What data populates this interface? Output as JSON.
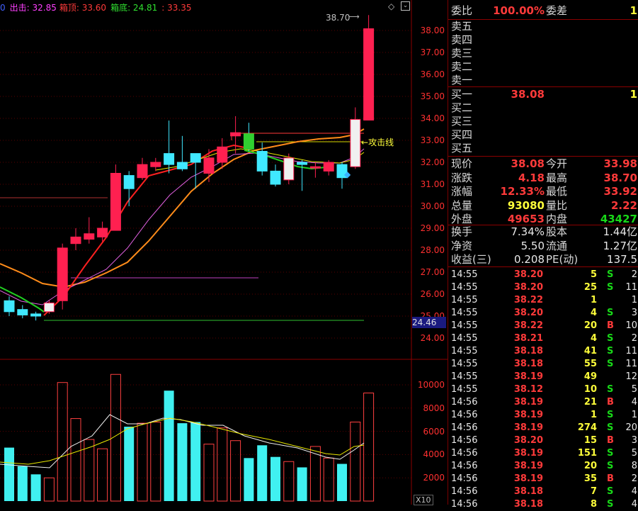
{
  "legend": {
    "prefix": "0",
    "chuji": "出击: 32.85",
    "xiangding": "箱顶: 33.60",
    "xiangdi": "箱底: 24.81",
    "extra": ": 33.35"
  },
  "chart_labels": {
    "peak": "38.70",
    "attack_line": "攻击线",
    "price_tag": "24.46",
    "vol_unit": "X10"
  },
  "price_axis": [
    "38.00",
    "37.00",
    "36.00",
    "35.00",
    "34.00",
    "33.00",
    "32.00",
    "31.00",
    "30.00",
    "29.00",
    "28.00",
    "27.00",
    "26.00",
    "25.00",
    "24.00"
  ],
  "vol_axis": [
    "10000",
    "8000",
    "6000",
    "4000",
    "2000"
  ],
  "chart_data": {
    "type": "candlestick",
    "ylim": [
      23.6,
      38.9
    ],
    "candles": [
      {
        "o": 25.7,
        "c": 25.2,
        "h": 25.9,
        "l": 25.0,
        "up": false
      },
      {
        "o": 25.3,
        "c": 25.05,
        "h": 25.5,
        "l": 24.9,
        "up": false
      },
      {
        "o": 25.1,
        "c": 25.0,
        "h": 25.2,
        "l": 24.8,
        "up": false
      },
      {
        "o": 25.2,
        "c": 25.6,
        "h": 25.7,
        "l": 25.1,
        "up": true,
        "white": true
      },
      {
        "o": 25.7,
        "c": 28.1,
        "h": 28.3,
        "l": 25.3,
        "up": true
      },
      {
        "o": 28.3,
        "c": 28.6,
        "h": 29.0,
        "l": 28.0,
        "up": true
      },
      {
        "o": 28.5,
        "c": 28.75,
        "h": 29.5,
        "l": 28.3,
        "up": true
      },
      {
        "o": 28.6,
        "c": 29.0,
        "h": 29.3,
        "l": 28.4,
        "up": true
      },
      {
        "o": 28.9,
        "c": 31.5,
        "h": 31.9,
        "l": 28.9,
        "up": true
      },
      {
        "o": 31.4,
        "c": 30.8,
        "h": 31.6,
        "l": 30.0,
        "up": false
      },
      {
        "o": 31.3,
        "c": 31.9,
        "h": 32.2,
        "l": 31.2,
        "up": true
      },
      {
        "o": 31.8,
        "c": 32.0,
        "h": 32.2,
        "l": 31.6,
        "up": true
      },
      {
        "o": 32.4,
        "c": 31.9,
        "h": 33.9,
        "l": 31.5,
        "up": false
      },
      {
        "o": 32.0,
        "c": 31.7,
        "h": 33.2,
        "l": 31.6,
        "up": false
      },
      {
        "o": 32.4,
        "c": 32.0,
        "h": 32.4,
        "l": 30.8,
        "up": false
      },
      {
        "o": 31.5,
        "c": 32.2,
        "h": 32.6,
        "l": 31.1,
        "up": true
      },
      {
        "o": 32.0,
        "c": 32.7,
        "h": 33.1,
        "l": 31.7,
        "up": true
      },
      {
        "o": 33.2,
        "c": 33.35,
        "h": 34.1,
        "l": 32.4,
        "up": true
      },
      {
        "o": 33.3,
        "c": 32.6,
        "h": 33.8,
        "l": 32.5,
        "up": false,
        "green": true
      },
      {
        "o": 32.5,
        "c": 31.6,
        "h": 32.9,
        "l": 31.4,
        "up": false
      },
      {
        "o": 31.6,
        "c": 31.0,
        "h": 31.9,
        "l": 30.9,
        "up": false
      },
      {
        "o": 31.2,
        "c": 32.2,
        "h": 32.4,
        "l": 31.0,
        "up": true,
        "white": true
      },
      {
        "o": 32.0,
        "c": 31.9,
        "h": 32.1,
        "l": 30.7,
        "up": false
      },
      {
        "o": 31.8,
        "c": 31.75,
        "h": 32.0,
        "l": 31.3,
        "up": true
      },
      {
        "o": 31.6,
        "c": 32.0,
        "h": 32.1,
        "l": 31.4,
        "up": true
      },
      {
        "o": 31.9,
        "c": 31.3,
        "h": 32.0,
        "l": 30.8,
        "up": false
      },
      {
        "o": 31.8,
        "c": 33.95,
        "h": 34.5,
        "l": 31.7,
        "up": true,
        "white": true
      },
      {
        "o": 33.92,
        "c": 38.08,
        "h": 38.7,
        "l": 33.92,
        "up": true
      }
    ],
    "volumes": [
      4600,
      3000,
      2300,
      2000,
      10200,
      7100,
      5300,
      4500,
      10900,
      6400,
      6700,
      6800,
      9500,
      6700,
      6800,
      4900,
      6300,
      5200,
      3700,
      4800,
      3800,
      3400,
      2900,
      4700,
      3700,
      3200,
      6800,
      9300
    ],
    "volume_ylim": [
      0,
      11500
    ]
  },
  "panel": {
    "weibi_label": "委比",
    "weibi_val": "100.00%",
    "weicha_label": "委差",
    "weicha_val": "1",
    "asks": [
      {
        "label": "卖五"
      },
      {
        "label": "卖四"
      },
      {
        "label": "卖三"
      },
      {
        "label": "卖二"
      },
      {
        "label": "卖一"
      }
    ],
    "bids": [
      {
        "label": "买一",
        "price": "38.08",
        "vol": "1"
      },
      {
        "label": "买二",
        "price": "",
        "vol": ""
      },
      {
        "label": "买三",
        "price": "",
        "vol": ""
      },
      {
        "label": "买四",
        "price": "",
        "vol": ""
      },
      {
        "label": "买五",
        "price": "",
        "vol": ""
      }
    ],
    "stats": [
      {
        "l1": "现价",
        "v1": "38.08",
        "c1": "red",
        "l2": "今开",
        "v2": "33.98",
        "c2": "red"
      },
      {
        "l1": "涨跌",
        "v1": "4.18",
        "c1": "red",
        "l2": "最高",
        "v2": "38.70",
        "c2": "red"
      },
      {
        "l1": "涨幅",
        "v1": "12.33%",
        "c1": "red",
        "l2": "最低",
        "v2": "33.92",
        "c2": "red"
      },
      {
        "l1": "总量",
        "v1": "93080",
        "c1": "yellow",
        "l2": "量比",
        "v2": "2.22",
        "c2": "red"
      },
      {
        "l1": "外盘",
        "v1": "49653",
        "c1": "red",
        "l2": "内盘",
        "v2": "43427",
        "c2": "green"
      }
    ],
    "stats2": [
      {
        "l1": "换手",
        "v1": "7.34%",
        "l2": "股本",
        "v2": "1.44亿"
      },
      {
        "l1": "净资",
        "v1": "5.50",
        "l2": "流通",
        "v2": "1.27亿"
      },
      {
        "l1": "收益(三)",
        "v1": "0.208",
        "l2": "PE(动)",
        "v2": "137.5"
      }
    ],
    "ticks": [
      {
        "t": "14:55",
        "p": "38.20",
        "v": "5",
        "s": "S",
        "n": "2"
      },
      {
        "t": "14:55",
        "p": "38.20",
        "v": "25",
        "s": "S",
        "n": "11"
      },
      {
        "t": "14:55",
        "p": "38.22",
        "v": "1",
        "s": "",
        "n": "1"
      },
      {
        "t": "14:55",
        "p": "38.20",
        "v": "4",
        "s": "S",
        "n": "3"
      },
      {
        "t": "14:55",
        "p": "38.22",
        "v": "20",
        "s": "B",
        "n": "10"
      },
      {
        "t": "14:55",
        "p": "38.21",
        "v": "4",
        "s": "S",
        "n": "2"
      },
      {
        "t": "14:55",
        "p": "38.18",
        "v": "41",
        "s": "S",
        "n": "11"
      },
      {
        "t": "14:55",
        "p": "38.18",
        "v": "55",
        "s": "S",
        "n": "11"
      },
      {
        "t": "14:55",
        "p": "38.19",
        "v": "49",
        "s": "",
        "n": "12"
      },
      {
        "t": "14:55",
        "p": "38.12",
        "v": "10",
        "s": "S",
        "n": "5"
      },
      {
        "t": "14:56",
        "p": "38.19",
        "v": "21",
        "s": "B",
        "n": "4"
      },
      {
        "t": "14:56",
        "p": "38.19",
        "v": "1",
        "s": "S",
        "n": "1"
      },
      {
        "t": "14:56",
        "p": "38.19",
        "v": "274",
        "s": "S",
        "n": "20"
      },
      {
        "t": "14:56",
        "p": "38.20",
        "v": "15",
        "s": "B",
        "n": "3"
      },
      {
        "t": "14:56",
        "p": "38.19",
        "v": "151",
        "s": "S",
        "n": "5"
      },
      {
        "t": "14:56",
        "p": "38.19",
        "v": "20",
        "s": "S",
        "n": "8"
      },
      {
        "t": "14:56",
        "p": "38.19",
        "v": "35",
        "s": "B",
        "n": "2"
      },
      {
        "t": "14:56",
        "p": "38.18",
        "v": "7",
        "s": "S",
        "n": "4"
      },
      {
        "t": "14:56",
        "p": "38.18",
        "v": "8",
        "s": "S",
        "n": "4"
      }
    ]
  }
}
